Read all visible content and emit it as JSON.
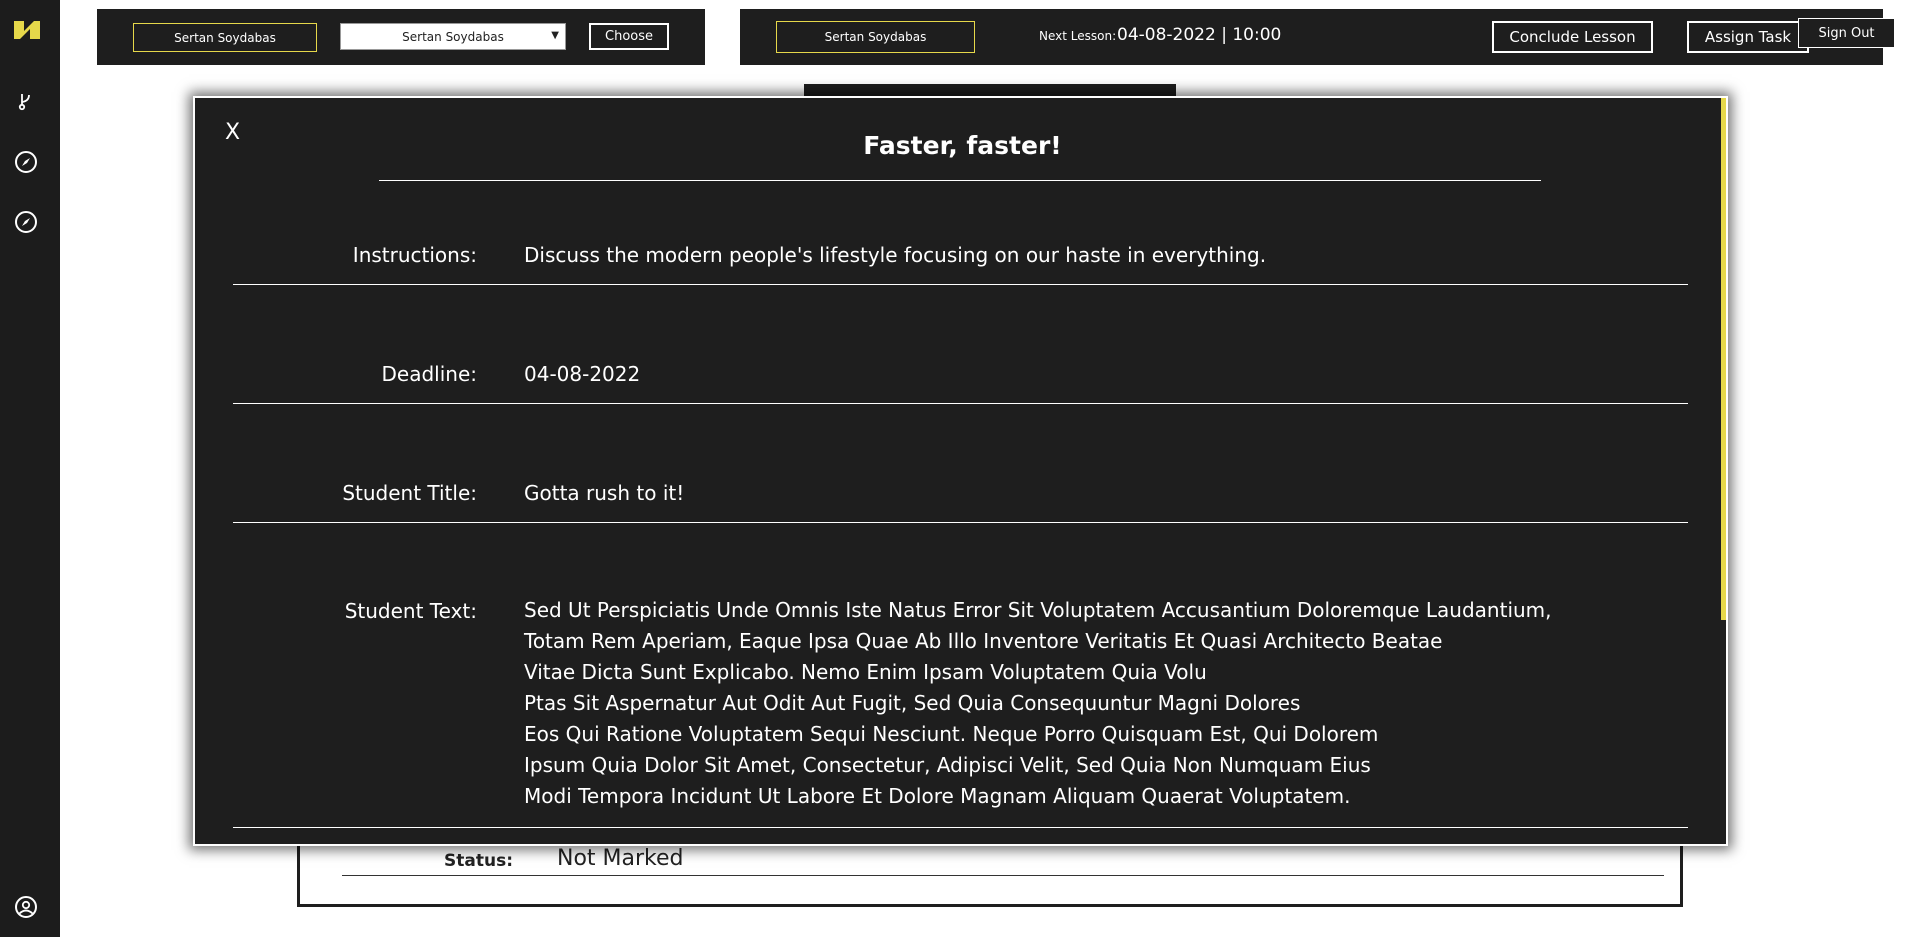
{
  "sidebar": {
    "items": [
      {
        "icon": "logo-icon"
      },
      {
        "icon": "branch-icon"
      },
      {
        "icon": "compass-icon"
      },
      {
        "icon": "compass-icon"
      },
      {
        "icon": "user-circle-icon"
      }
    ]
  },
  "header_left": {
    "student_name": "Sertan Soydabas",
    "selected_student": "Sertan Soydabas",
    "choose_label": "Choose"
  },
  "header_right": {
    "student_name": "Sertan Soydabas",
    "next_lesson_label": "Next Lesson:",
    "next_lesson_value": "04-08-2022 | 10:00",
    "conclude_label": "Conclude Lesson",
    "assign_label": "Assign Task",
    "signout_label": "Sign Out"
  },
  "background_card": {
    "status_label": "Status:",
    "status_value": "Not Marked"
  },
  "modal": {
    "close_label": "X",
    "title": "Faster, faster!",
    "instructions_label": "Instructions:",
    "instructions_value": "Discuss the modern people's lifestyle focusing on our haste in everything.",
    "deadline_label": "Deadline:",
    "deadline_value": "04-08-2022",
    "student_title_label": "Student Title:",
    "student_title_value": "Gotta rush to it!",
    "student_text_label": "Student Text:",
    "student_text_lines": [
      "Sed Ut Perspiciatis Unde Omnis Iste Natus Error Sit Voluptatem Accusantium Doloremque Laudantium,",
      "Totam Rem Aperiam, Eaque Ipsa Quae Ab Illo Inventore Veritatis Et Quasi Architecto Beatae",
      "Vitae Dicta Sunt Explicabo. Nemo Enim Ipsam Voluptatem Quia Volu",
      "Ptas Sit Aspernatur Aut Odit Aut Fugit, Sed Quia Consequuntur Magni Dolores",
      "Eos Qui Ratione Voluptatem Sequi Nesciunt. Neque Porro Quisquam Est, Qui Dolorem",
      "Ipsum Quia Dolor Sit Amet, Consectetur, Adipisci Velit, Sed Quia Non Numquam Eius",
      "Modi Tempora Incidunt Ut Labore Et Dolore Magnam Aliquam Quaerat Voluptatem."
    ]
  },
  "colors": {
    "accent": "#e6d84a",
    "dark": "#1e1e1e",
    "text": "#ffffff"
  }
}
